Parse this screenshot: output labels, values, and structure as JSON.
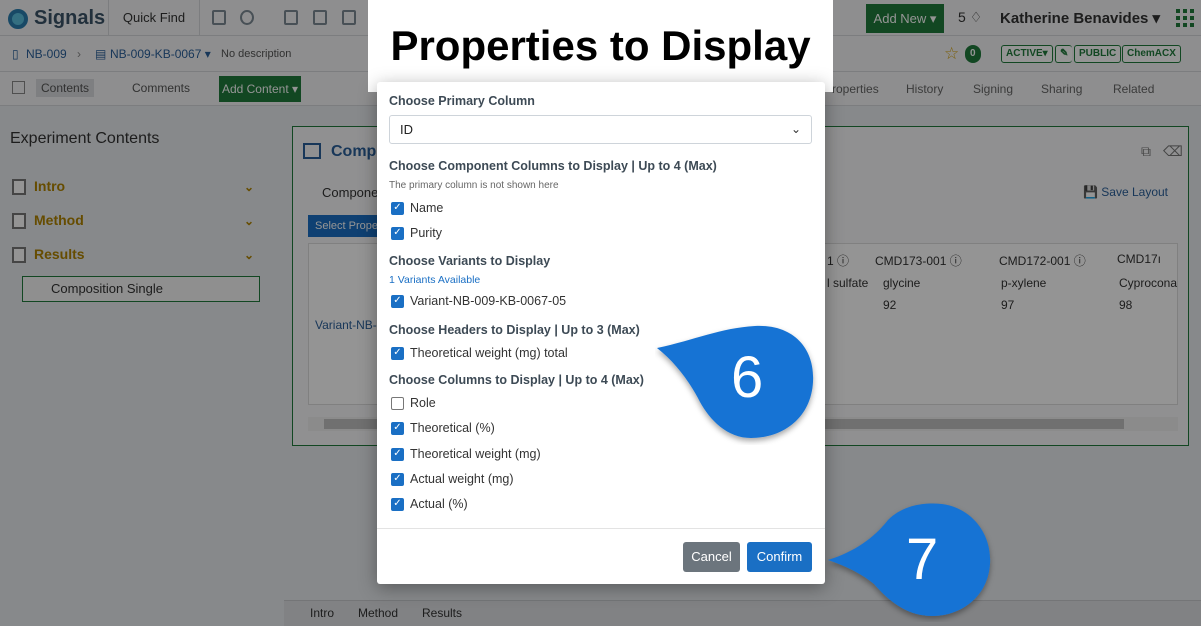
{
  "app": {
    "logo_text": "Signals",
    "quick_find": "Quick Find",
    "add_new": "Add New ▾",
    "notifications": "5",
    "user_name": "Katherine Benavides ▾"
  },
  "breadcrumb": {
    "notebook": "NB-009",
    "experiment": "NB-009-KB-0067 ▾",
    "description": "No description",
    "comments_count": "0",
    "status": "ACTIVE▾",
    "visibility": "PUBLIC",
    "chem": "ChemACX"
  },
  "tabs": {
    "contents": "Contents",
    "comments": "Comments",
    "add_content": "Add Content ▾",
    "properties": "roperties",
    "history": "History",
    "signing": "Signing",
    "sharing": "Sharing",
    "related": "Related"
  },
  "sidebar": {
    "title": "Experiment Contents",
    "items": [
      {
        "label": "Intro"
      },
      {
        "label": "Method"
      },
      {
        "label": "Results"
      }
    ],
    "sub_item": "Composition Single"
  },
  "main": {
    "title": "Compo",
    "component_label": "Compone",
    "select_button": "Select Prope",
    "save_layout": "Save Layout",
    "variant_link": "Variant-NB-",
    "columns": [
      {
        "id": "1 ⓘ",
        "name": "l sulfate",
        "purity": ""
      },
      {
        "id": "CMD173-001 ⓘ",
        "name": "glycine",
        "purity": "92"
      },
      {
        "id": "CMD172-001 ⓘ",
        "name": "p-xylene",
        "purity": "97"
      },
      {
        "id": "CMD17ı",
        "name": "Cyprocona",
        "purity": "98"
      }
    ]
  },
  "bottom_tabs": [
    "Intro",
    "Method",
    "Results"
  ],
  "banner_title": "Properties to Display",
  "modal": {
    "primary_heading": "Choose Primary Column",
    "primary_value": "ID",
    "component_heading": "Choose Component Columns to Display | Up to 4 (Max)",
    "component_note": "The primary column is not shown here",
    "component_options": [
      {
        "label": "Name",
        "checked": true
      },
      {
        "label": "Purity",
        "checked": true
      }
    ],
    "variants_heading": "Choose Variants to Display",
    "variants_available": "1 Variants Available",
    "variant_options": [
      {
        "label": "Variant-NB-009-KB-0067-05",
        "checked": true
      }
    ],
    "headers_heading": "Choose Headers to Display | Up to 3 (Max)",
    "header_options": [
      {
        "label": "Theoretical weight (mg) total",
        "checked": true
      }
    ],
    "columns_heading": "Choose Columns to Display | Up to 4 (Max)",
    "column_options": [
      {
        "label": "Role",
        "checked": false
      },
      {
        "label": "Theoretical (%)",
        "checked": true
      },
      {
        "label": "Theoretical weight (mg)",
        "checked": true
      },
      {
        "label": "Actual weight (mg)",
        "checked": true
      },
      {
        "label": "Actual (%)",
        "checked": true
      }
    ],
    "cancel": "Cancel",
    "confirm": "Confirm"
  },
  "callouts": [
    {
      "number": "6",
      "color": "#1773d4"
    },
    {
      "number": "7",
      "color": "#1773d4"
    }
  ]
}
